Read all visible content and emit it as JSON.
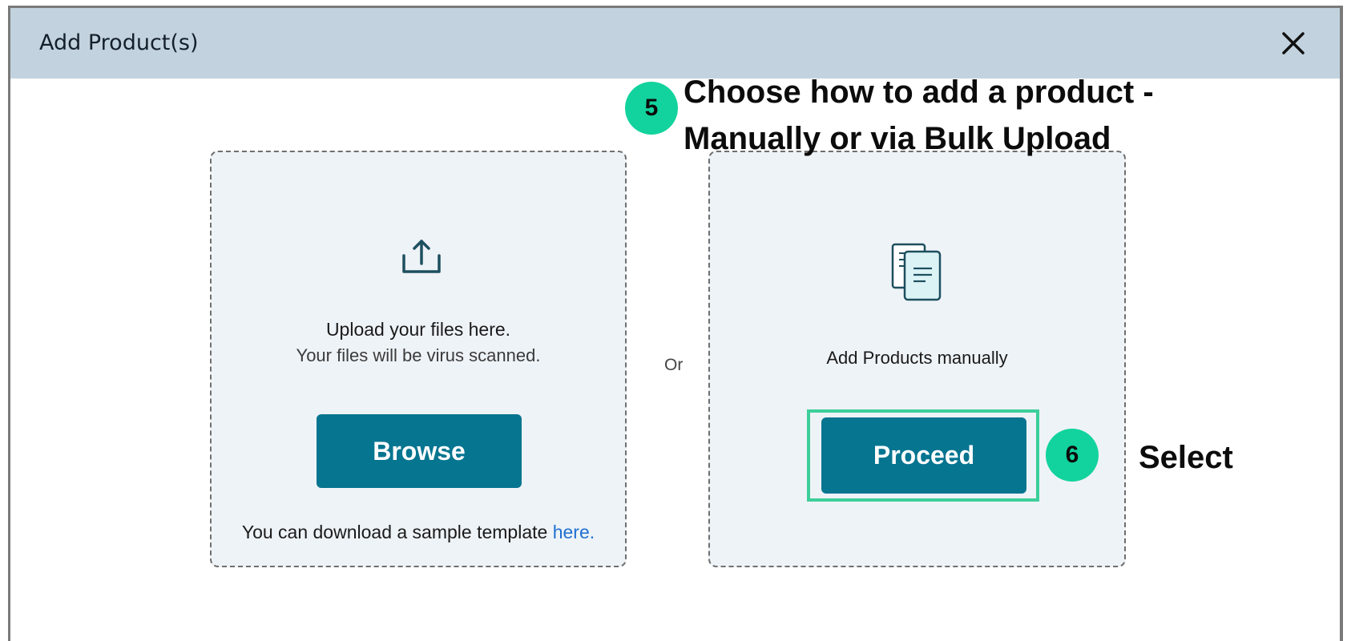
{
  "dialog": {
    "title": "Add Product(s)",
    "close_icon": "close-icon"
  },
  "upload_card": {
    "icon": "upload-icon",
    "title": "Upload your files here.",
    "subtitle": "Your files will be virus scanned.",
    "browse_label": "Browse",
    "template_text": "You can download a sample template ",
    "template_link": "here."
  },
  "separator": {
    "or_label": "Or"
  },
  "manual_card": {
    "icon": "document-icon",
    "label": "Add Products manually",
    "proceed_label": "Proceed"
  },
  "annotations": {
    "step5": {
      "number": "5",
      "line1": "Choose how to add a product -",
      "line2": "Manually or via Bulk Upload"
    },
    "step6": {
      "number": "6",
      "text": "Select"
    },
    "highlight_color": "#3ccf9a",
    "badge_color": "#12d39d"
  },
  "colors": {
    "header_bg": "#c2d3df",
    "button_bg": "#067590",
    "card_bg": "#eef3f7",
    "link": "#1f6fd1"
  }
}
